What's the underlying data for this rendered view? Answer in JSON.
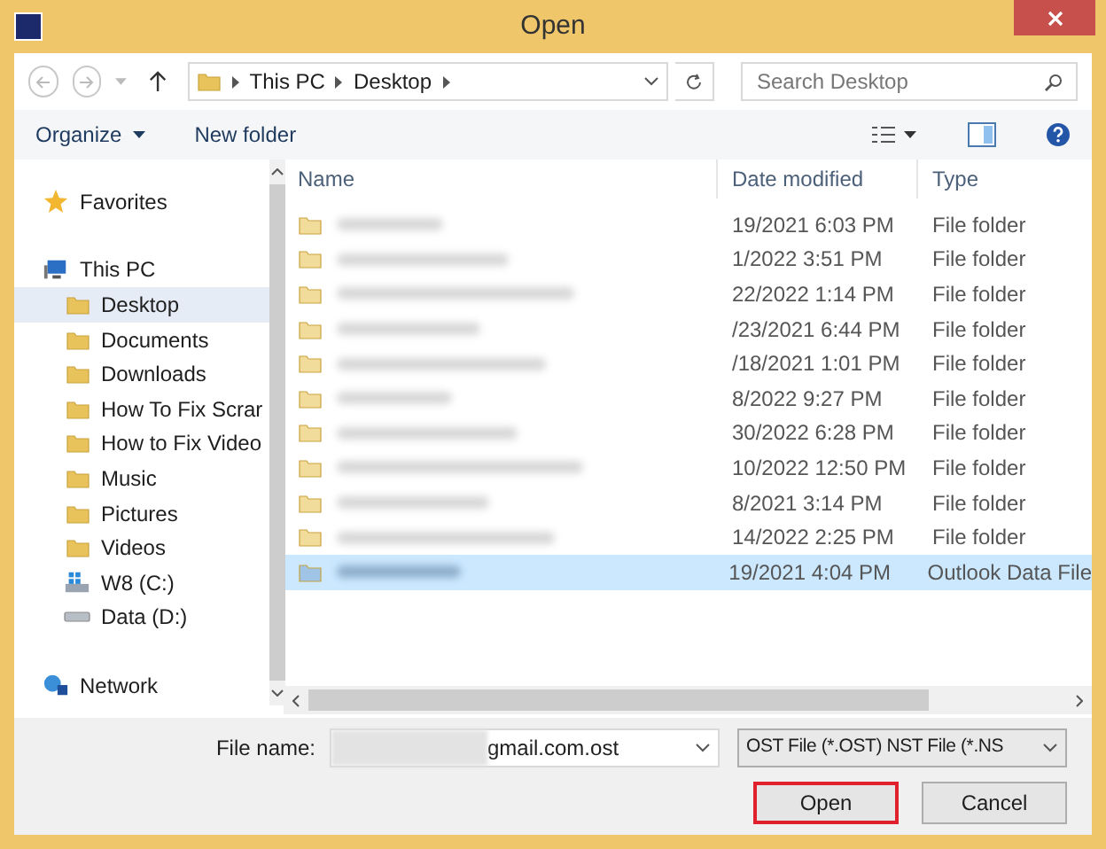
{
  "window": {
    "title": "Open"
  },
  "address": {
    "crumbs": [
      "This PC",
      "Desktop"
    ]
  },
  "search": {
    "placeholder": "Search Desktop"
  },
  "toolbar": {
    "organize": "Organize",
    "new_folder": "New folder"
  },
  "sidebar": {
    "items": [
      {
        "label": "Favorites",
        "kind": "favorites",
        "selected": false
      },
      {
        "label": "This PC",
        "kind": "computer",
        "selected": false,
        "children": [
          {
            "label": "Desktop",
            "kind": "folder",
            "selected": true
          },
          {
            "label": "Documents",
            "kind": "folder",
            "selected": false
          },
          {
            "label": "Downloads",
            "kind": "folder",
            "selected": false
          },
          {
            "label": "How To Fix Scrar",
            "kind": "folder",
            "selected": false
          },
          {
            "label": "How to Fix Video",
            "kind": "folder",
            "selected": false
          },
          {
            "label": "Music",
            "kind": "folder",
            "selected": false
          },
          {
            "label": "Pictures",
            "kind": "folder",
            "selected": false
          },
          {
            "label": "Videos",
            "kind": "folder",
            "selected": false
          },
          {
            "label": "W8 (C:)",
            "kind": "system_drive",
            "selected": false
          },
          {
            "label": "Data (D:)",
            "kind": "drive",
            "selected": false
          }
        ]
      },
      {
        "label": "Network",
        "kind": "network",
        "selected": false
      }
    ]
  },
  "table": {
    "columns": [
      "Name",
      "Date modified",
      "Type"
    ],
    "rows": [
      {
        "date": "19/2021 6:03 PM",
        "type": "File folder",
        "selected": false
      },
      {
        "date": "1/2022 3:51 PM",
        "type": "File folder",
        "selected": false
      },
      {
        "date": "22/2022 1:14 PM",
        "type": "File folder",
        "selected": false
      },
      {
        "date": "/23/2021 6:44 PM",
        "type": "File folder",
        "selected": false
      },
      {
        "date": "/18/2021 1:01 PM",
        "type": "File folder",
        "selected": false
      },
      {
        "date": "8/2022 9:27 PM",
        "type": "File folder",
        "selected": false
      },
      {
        "date": "30/2022 6:28 PM",
        "type": "File folder",
        "selected": false
      },
      {
        "date": "10/2022 12:50 PM",
        "type": "File folder",
        "selected": false
      },
      {
        "date": "8/2021 3:14 PM",
        "type": "File folder",
        "selected": false
      },
      {
        "date": "14/2022 2:25 PM",
        "type": "File folder",
        "selected": false
      },
      {
        "date": "19/2021 4:04 PM",
        "type": "Outlook Data File",
        "selected": true
      }
    ]
  },
  "footer": {
    "file_name_label": "File name:",
    "file_name_value": "gmail.com.ost",
    "file_type": "OST File (*.OST) NST File (*.NS",
    "buttons": [
      {
        "label": "Open",
        "highlighted": true
      },
      {
        "label": "Cancel",
        "highlighted": false
      }
    ]
  }
}
